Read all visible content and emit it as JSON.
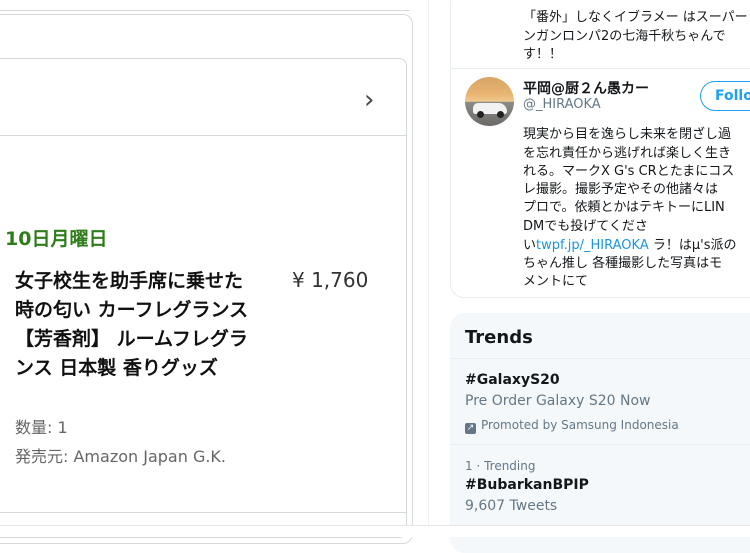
{
  "amazon": {
    "date": "10日月曜日",
    "product_title": "女子校生を助手席に乗せた時の匂い カーフレグランス 【芳香剤】 ルームフレグランス 日本製 香りグッズ",
    "price": "¥ 1,760",
    "quantity": "数量: 1",
    "seller": "発売元: Amazon Japan G.K.",
    "chevron": "›"
  },
  "twitter": {
    "prev_tweet_lines": [
      "「番外」しなくイブラメー はスーパー",
      "ンガンロンパ2の七海千秋ちゃんで",
      "す！！"
    ],
    "user": {
      "display_name": "平岡@厨２ん愚カー",
      "handle": "@_HIRAOKA",
      "follow_label": "Follow",
      "bio_lines": [
        "現実から目を逸らし未来を閉ざし過",
        "を忘れ責任から逃げれば楽しく生き",
        "れる。マークX G's CRとたまにコス",
        "レ撮影。撮影予定やその他諸々は",
        "プロで。依頼とかはテキトーにLIN",
        "DMでも投げてくださ"
      ],
      "bio_link_prefix": "い",
      "bio_link": "twpf.jp/_HIRAOKA",
      "bio_link_suffix": " ラ！はµ's派の",
      "bio_lines_after": [
        "ちゃん推し 各種撮影した写真はモ",
        "メントにて"
      ]
    },
    "trends": {
      "title": "Trends",
      "items": [
        {
          "tag": "#GalaxyS20",
          "sub": "Pre Order Galaxy S20 Now",
          "meta": "Promoted by Samsung Indonesia"
        },
        {
          "rank": "1 · Trending",
          "tag": "#BubarkanBPIP",
          "sub": "9,607 Tweets"
        }
      ]
    }
  }
}
